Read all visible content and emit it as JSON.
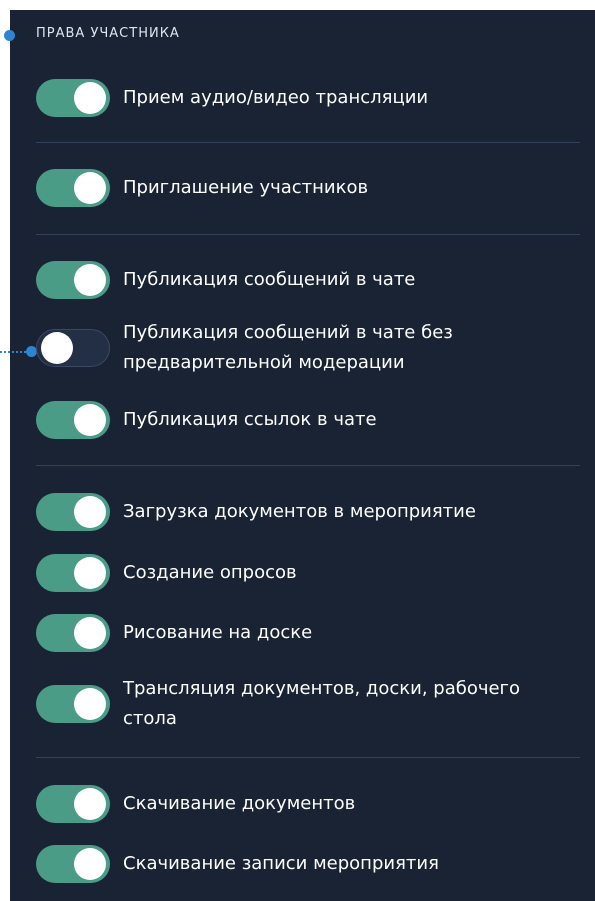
{
  "section": {
    "title": "ПРАВА УЧАСТНИКА"
  },
  "colors": {
    "panel_bg": "#1a2334",
    "toggle_on": "#4a9c86",
    "toggle_off": "#232f45",
    "pointer": "#2d85d2"
  },
  "permissions": [
    {
      "label": "Прием аудио/видео трансляции",
      "enabled": true
    },
    {
      "label": "Приглашение участников",
      "enabled": true
    },
    {
      "label": "Публикация сообщений в чате",
      "enabled": true
    },
    {
      "label": "Публикация сообщений в чате без предварительной модерации",
      "enabled": false
    },
    {
      "label": "Публикация ссылок в чате",
      "enabled": true
    },
    {
      "label": "Загрузка документов в мероприятие",
      "enabled": true
    },
    {
      "label": "Создание опросов",
      "enabled": true
    },
    {
      "label": "Рисование на доске",
      "enabled": true
    },
    {
      "label": "Трансляция документов, доски, рабочего стола",
      "enabled": true
    },
    {
      "label": "Скачивание документов",
      "enabled": true
    },
    {
      "label": "Скачивание записи мероприятия",
      "enabled": true
    }
  ]
}
